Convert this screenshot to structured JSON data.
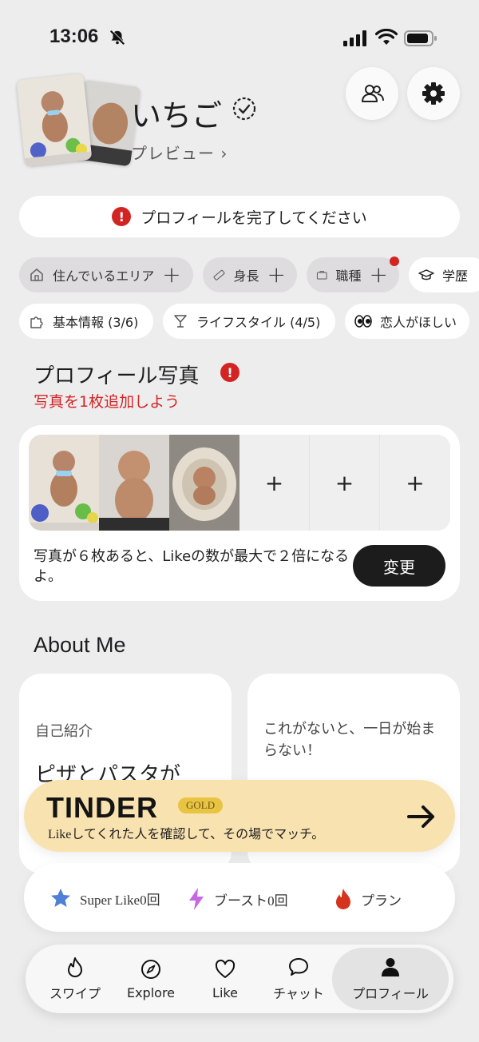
{
  "status_bar": {
    "time": "13:06"
  },
  "profile": {
    "name": "いちご",
    "preview_label": "プレビュー"
  },
  "banner": {
    "text": "プロフィールを完了してください"
  },
  "chips_row1": [
    "住んでいるエリア",
    "身長",
    "職種",
    "学歴"
  ],
  "chips_row2": [
    "基本情報 (3/6)",
    "ライフスタイル (4/5)",
    "恋人がほしい"
  ],
  "photos_section": {
    "title": "プロフィール写真",
    "subtitle": "写真を1枚追加しよう",
    "hint": "写真が６枚あると、Likeの数が最大で２倍になるよ。",
    "change_button": "変更",
    "add_symbol": "+"
  },
  "about": {
    "title": "About Me",
    "card1_label": "自己紹介",
    "card1_text": "ピザとパスタが",
    "card2_text": "これがないと、一日が始まらない！"
  },
  "gold": {
    "logo": "TINDER",
    "badge": "GOLD",
    "tagline": "Likeしてくれた人を確認して、その場でマッチ。"
  },
  "stats": {
    "super_like": "Super Like0回",
    "boost": "ブースト0回",
    "plan": "プラン"
  },
  "tabs": [
    "スワイプ",
    "Explore",
    "Like",
    "チャット",
    "プロフィール"
  ],
  "colors": {
    "alert_red": "#d32424",
    "gold_bg": "#f8e2b0",
    "gold_badge": "#e8c443",
    "star_blue": "#4f7fd6",
    "boost_purple": "#c469e3",
    "flame_red": "#d6331f"
  }
}
